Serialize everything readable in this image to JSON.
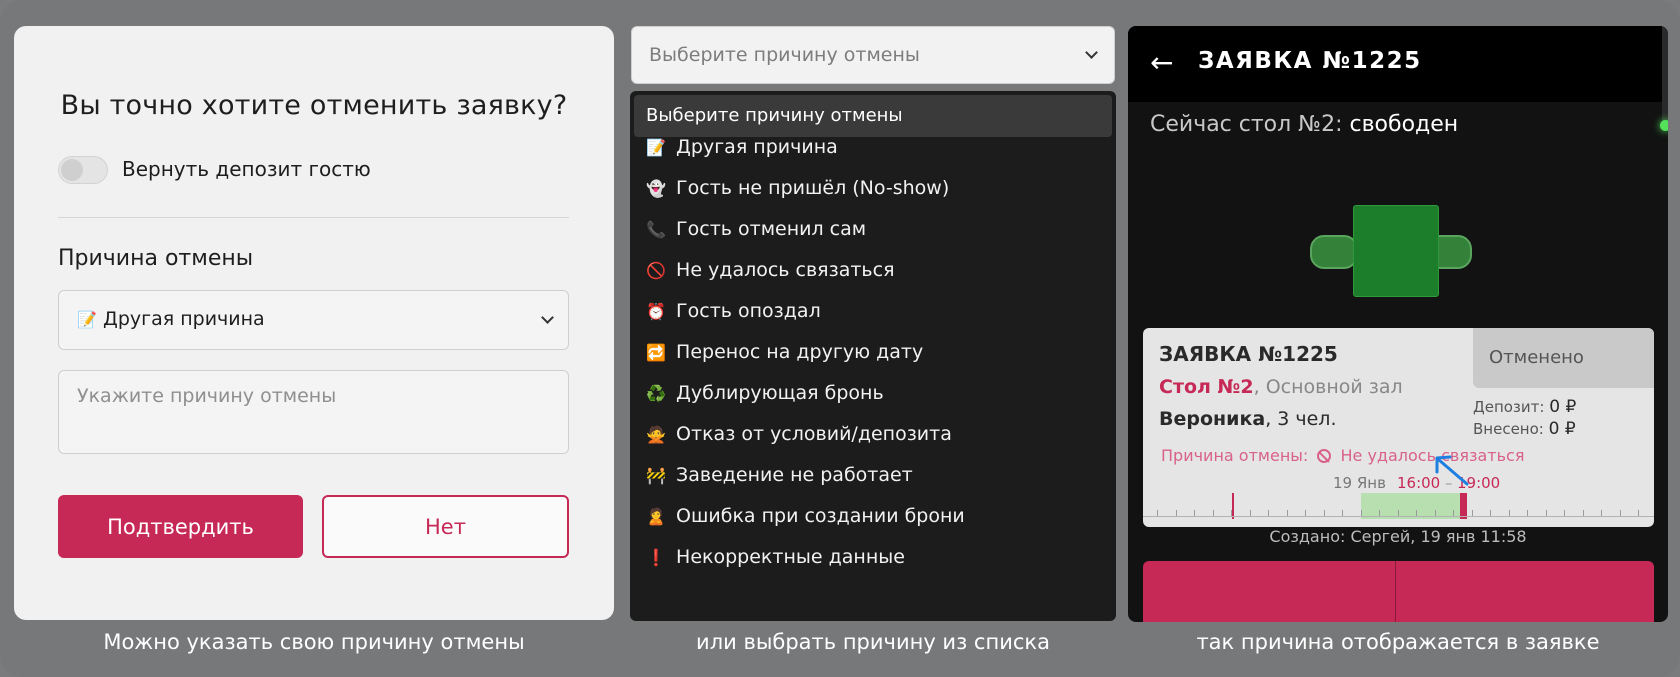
{
  "panel1": {
    "title": "Вы точно хотите отменить заявку?",
    "toggle_label": "Вернуть депозит гостю",
    "reason_heading": "Причина отмены",
    "select_emoji": "📝",
    "select_value": "Другая причина",
    "textarea_placeholder": "Укажите причину отмены",
    "confirm_label": "Подтвердить",
    "no_label": "Нет",
    "caption": "Можно указать свою причину отмены"
  },
  "panel2": {
    "select_placeholder": "Выберите причину отмены",
    "dropdown_header": "Выберите причину отмены",
    "items": [
      {
        "emoji": "📝",
        "label": "Другая причина"
      },
      {
        "emoji": "👻",
        "label": "Гость не пришёл (No-show)"
      },
      {
        "emoji": "📞",
        "label": "Гость отменил сам"
      },
      {
        "emoji": "🚫",
        "label": "Не удалось связаться"
      },
      {
        "emoji": "⏰",
        "label": "Гость опоздал"
      },
      {
        "emoji": "🔁",
        "label": "Перенос на другую дату"
      },
      {
        "emoji": "♻️",
        "label": "Дублирующая бронь"
      },
      {
        "emoji": "🙅",
        "label": "Отказ от условий/депозита"
      },
      {
        "emoji": "🚧",
        "label": "Заведение не работает"
      },
      {
        "emoji": "🙎",
        "label": "Ошибка при создании брони"
      },
      {
        "emoji": "❗",
        "label": "Некорректные данные"
      }
    ],
    "caption": "или выбрать причину из списка"
  },
  "panel3": {
    "back_icon": "←",
    "title": "ЗАЯВКА №1225",
    "status_prefix": "Сейчас стол №2:",
    "status_value": "свободен",
    "card": {
      "id": "ЗАЯВКА №1225",
      "table": "Стол №2",
      "hall": ", Основной зал",
      "guest_name": "Вероника",
      "guests": ", 3 чел.",
      "badge": "Отменено",
      "deposit_label": "Депозит:",
      "deposit_value": "0 ₽",
      "paid_label": "Внесено:",
      "paid_value": "0 ₽",
      "reason_label": "Причина отмены:",
      "reason_value": "Не удалось связаться",
      "date": "19 Янв",
      "time_start": "16:00",
      "time_sep": "–",
      "time_end": "19:00"
    },
    "created": "Создано: Сергей, 19 янв 11:58",
    "caption": "так причина отображается в заявке"
  },
  "colors": {
    "accent": "#c72957",
    "status_dot": "#53e25a",
    "table_green": "#1c7d2a",
    "arrow_blue": "#1f7fe0"
  }
}
